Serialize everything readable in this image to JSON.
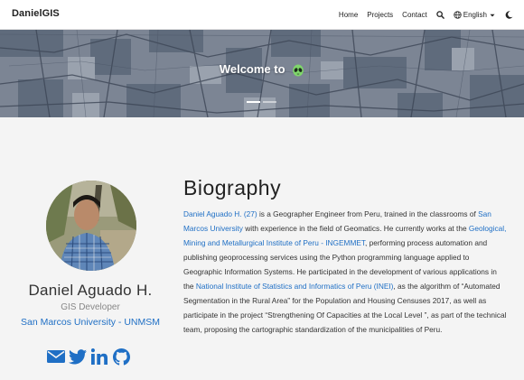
{
  "navbar": {
    "brand": "DanielGIS",
    "links": [
      "Home",
      "Projects",
      "Contact"
    ],
    "language": "English",
    "icons": [
      "search-icon",
      "globe-icon",
      "caret-down-icon",
      "moon-icon"
    ]
  },
  "hero": {
    "title": "Welcome to",
    "emoji": "alien-icon",
    "carousel_slides": 2,
    "active_slide": 1
  },
  "profile": {
    "name": "Daniel Aguado H.",
    "role": "GIS Developer",
    "university": "San Marcos University - UNMSM",
    "social_icons": [
      "email-icon",
      "twitter-icon",
      "linkedin-icon",
      "github-icon"
    ]
  },
  "biography": {
    "title": "Biography",
    "p1_link": "Daniel Aguado H. (27)",
    "p2": " is a Geographer Engineer from Peru, trained in the classrooms of ",
    "p3_link": "San Marcos University",
    "p4": " with experience in the field of Geomatics. He currently works at the ",
    "p5_link": "Geological, Mining and Metallurgical Institute of Peru - INGEMMET",
    "p6": ", performing process automation and publishing geoprocessing services using the Python programming language applied to Geographic Information Systems. He participated in the development of various applications in the ",
    "p7_link": "National Institute of Statistics and Informatics of Peru (INEI)",
    "p8": ", as the algorithm of “Automated Segmentation in the Rural Area” for the Population and Housing Censuses 2017, as well as participate in the project “Strengthening Of Capacities at the Local Level ”, as part of the technical team, proposing the cartographic standardization of the municipalities of Peru."
  },
  "colors": {
    "accent": "#1f6fc5",
    "hero_bg": "#7d8694",
    "page_bg": "#f4f4f4"
  }
}
